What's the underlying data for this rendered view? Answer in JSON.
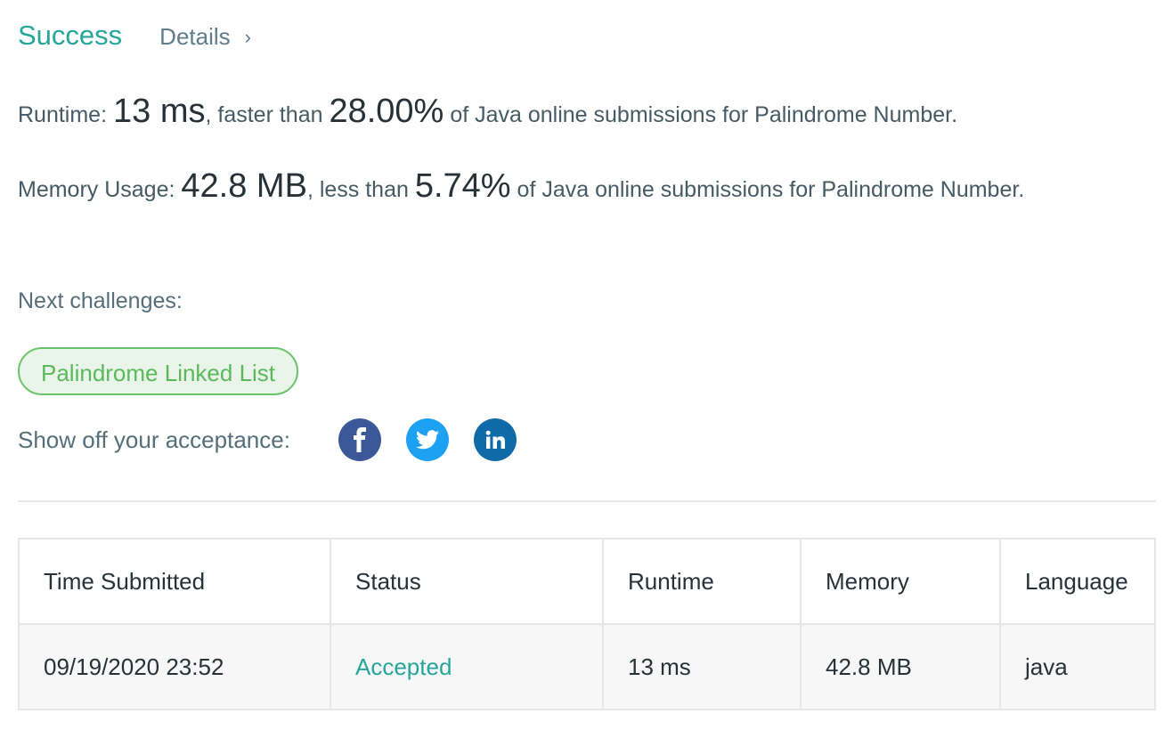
{
  "header": {
    "status": "Success",
    "details_label": "Details",
    "details_chevron": "›"
  },
  "runtime": {
    "label": "Runtime:",
    "value": "13 ms",
    "connector": ", faster than",
    "percent": "28.00%",
    "suffix": "of Java online submissions for Palindrome Number."
  },
  "memory": {
    "label": "Memory Usage:",
    "value": "42.8 MB",
    "connector": ", less than",
    "percent": "5.74%",
    "suffix": "of Java online submissions for Palindrome Number."
  },
  "next": {
    "label": "Next challenges:",
    "challenges": [
      "Palindrome Linked List"
    ]
  },
  "share": {
    "label": "Show off your acceptance:",
    "icons": [
      {
        "name": "facebook-icon",
        "color": "#3b5998"
      },
      {
        "name": "twitter-icon",
        "color": "#1da1f2"
      },
      {
        "name": "linkedin-icon",
        "color": "#0e6ba8"
      }
    ]
  },
  "table": {
    "headers": [
      "Time Submitted",
      "Status",
      "Runtime",
      "Memory",
      "Language"
    ],
    "rows": [
      [
        "09/19/2020 23:52",
        "Accepted",
        "13 ms",
        "42.8 MB",
        "java"
      ]
    ]
  },
  "colors": {
    "success": "#26a69a",
    "accepted": "#26a69a",
    "challenge_border": "#6dc36d",
    "challenge_bg": "#e9f5e9"
  }
}
